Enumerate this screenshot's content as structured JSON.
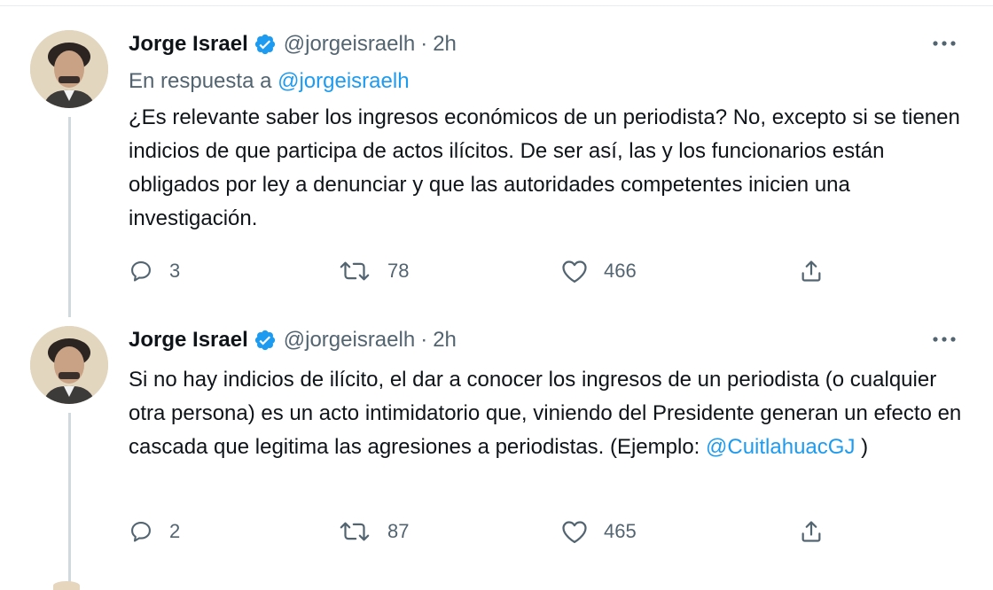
{
  "tweets": [
    {
      "author": {
        "name": "Jorge Israel",
        "handle": "@jorgeisraelh",
        "separator": "·",
        "time": "2h",
        "verified": true
      },
      "reply_to": {
        "prefix": "En respuesta a",
        "handle": "@jorgeisraelh"
      },
      "text": "¿Es relevante saber los ingresos económicos de un periodista? No, excepto si se tienen indicios de que participa de actos ilícitos. De ser así, las y los funcionarios están obligados por ley a denunciar y que las autoridades competentes inicien una investigación.",
      "stats": {
        "replies": "3",
        "retweets": "78",
        "likes": "466"
      }
    },
    {
      "author": {
        "name": "Jorge Israel",
        "handle": "@jorgeisraelh",
        "separator": "·",
        "time": "2h",
        "verified": true
      },
      "text_before_mention": "Si no hay indicios de ilícito, el dar a conocer los ingresos de un periodista (o cualquier otra persona) es un acto intimidatorio que, viniendo del Presidente generan un efecto en cascada que legitima las agresiones a periodistas. (Ejemplo: ",
      "mention": "@CuitlahuacGJ",
      "text_after_mention": " )",
      "stats": {
        "replies": "2",
        "retweets": "87",
        "likes": "465"
      }
    }
  ],
  "colors": {
    "accent": "#1d9bf0",
    "secondary_text": "#536471",
    "primary_text": "#0f1419",
    "thread_line": "#cfd9de"
  },
  "icons": [
    "verified-badge-icon",
    "more-icon",
    "reply-icon",
    "retweet-icon",
    "like-icon",
    "share-icon"
  ]
}
